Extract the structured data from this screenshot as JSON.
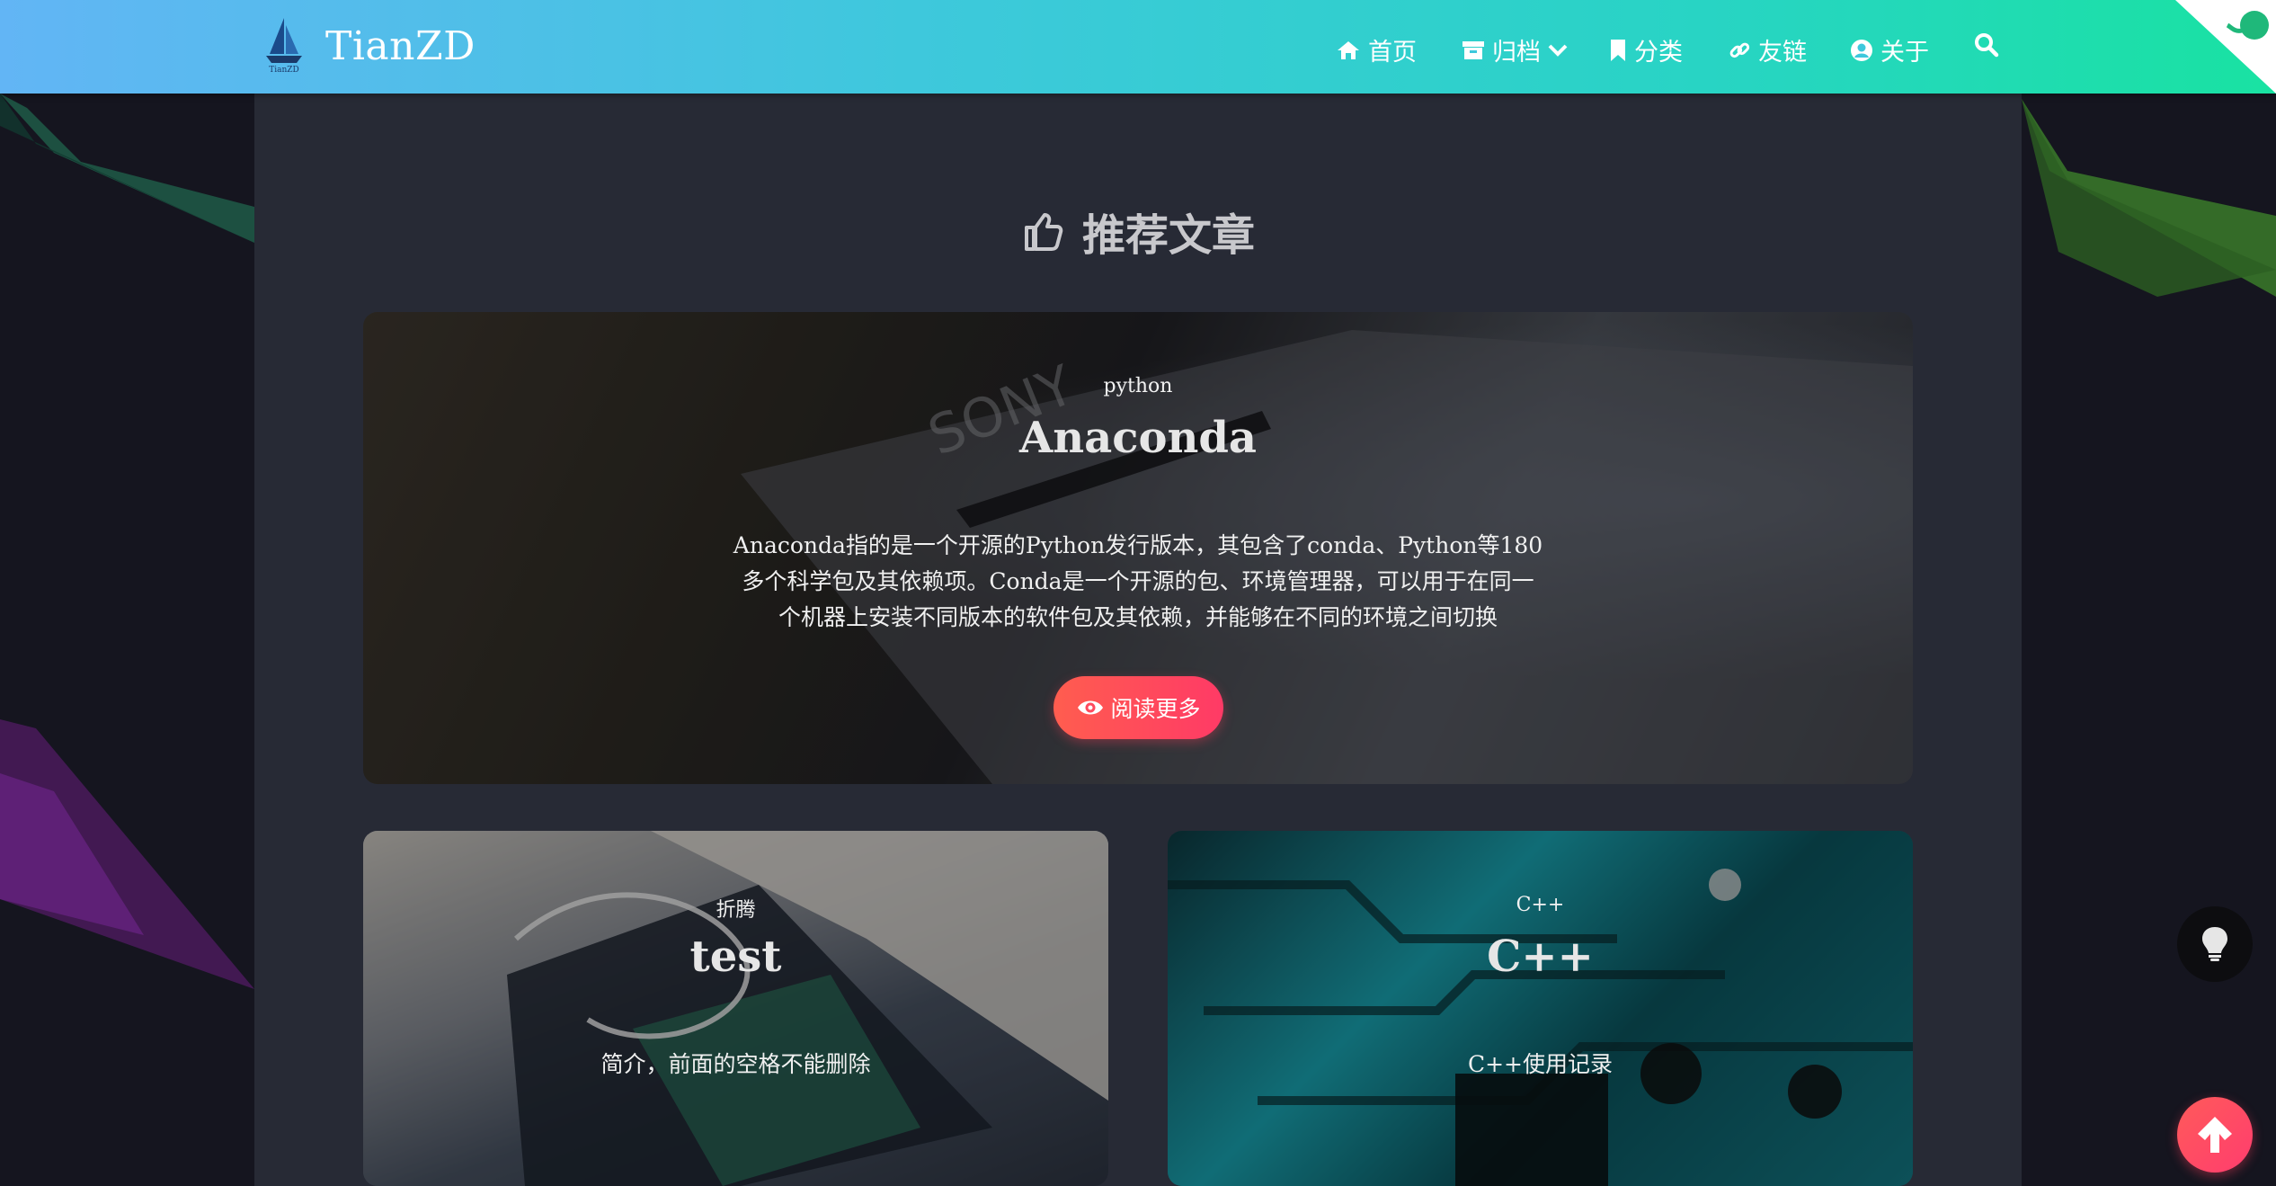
{
  "header": {
    "brand": "TianZD",
    "logo_text": "TianZD",
    "nav": [
      {
        "label": "首页",
        "icon": "home-icon"
      },
      {
        "label": "归档",
        "icon": "archive-icon"
      },
      {
        "label": "分类",
        "icon": "bookmark-icon"
      },
      {
        "label": "友链",
        "icon": "link-icon"
      },
      {
        "label": "关于",
        "icon": "user-circle-icon"
      }
    ],
    "search_icon": "search-icon",
    "corner_icon": "github-octocat-icon"
  },
  "section": {
    "title": "推荐文章",
    "icon": "thumbs-up-icon"
  },
  "featured": {
    "category": "python",
    "title": "Anaconda",
    "desc_lines": [
      "Anaconda指的是一个开源的Python发行版本，其包含了conda、Python等180",
      "多个科学包及其依赖项。Conda是一个开源的包、环境管理器，可以用于在同一",
      "个机器上安装不同版本的软件包及其依赖，并能够在不同的环境之间切换"
    ],
    "button_label": "阅读更多",
    "button_icon": "eye-icon"
  },
  "cards": [
    {
      "category": "折腾",
      "title": "test",
      "desc": "简介，前面的空格不能删除"
    },
    {
      "category": "C++",
      "title": "C++",
      "desc": "C++使用记录"
    }
  ],
  "floating": {
    "theme_icon": "lightbulb-icon",
    "top_icon": "arrow-up-icon"
  },
  "colors": {
    "header_gradient_start": "#62b5f5",
    "header_gradient_end": "#19e2a2",
    "accent": "#ff4a5e",
    "panel": "#272a35",
    "background": "#15151f"
  }
}
